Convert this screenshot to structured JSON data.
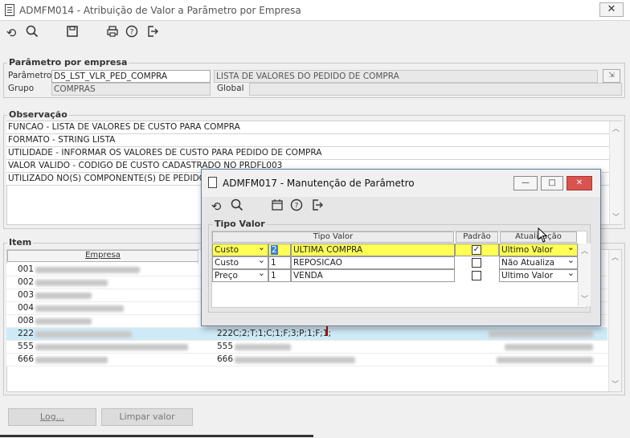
{
  "window": {
    "title": "ADMFM014 - Atribuição de Valor a Parâmetro por Empresa",
    "close_glyph": "✕"
  },
  "toolbar": {
    "icons": [
      "refresh-icon",
      "search-icon",
      "save-icon",
      "print-icon",
      "help-icon",
      "exit-icon"
    ]
  },
  "parametro_group": {
    "title": "Parâmetro por empresa",
    "parametro_label": "Parâmetro",
    "parametro_value": "DS_LST_VLR_PED_COMPRA",
    "parametro_desc": "LISTA DE VALORES DO PEDIDO DE COMPRA",
    "grupo_label": "Grupo",
    "grupo_value": "COMPRAS",
    "global_label": "Global",
    "global_value": ""
  },
  "observacao": {
    "title": "Observação",
    "lines": [
      "FUNCAO - LISTA DE VALORES DE CUSTO PARA COMPRA",
      "FORMATO - STRING LISTA",
      "UTILIDADE - INFORMAR OS VALORES DE CUSTO PARA PEDIDO DE COMPRA",
      "VALOR VALIDO - CODIGO DE CUSTO CADASTRADO NO PRDFL003",
      "UTILIZADO NO(S) COMPONENTE(S) DE PEDIDO DE COMPRA"
    ]
  },
  "item": {
    "title": "Item",
    "col_empresa": "Empresa",
    "rows": [
      {
        "code": "001",
        "code2": "",
        "value": ""
      },
      {
        "code": "002",
        "code2": "",
        "value": ""
      },
      {
        "code": "003",
        "code2": "",
        "value": ""
      },
      {
        "code": "004",
        "code2": "",
        "value": ""
      },
      {
        "code": "008",
        "code2": "",
        "value": ""
      },
      {
        "code": "222",
        "code2": "222",
        "value": "C;2;T;1;C;1;F;3;P;1;F;1;"
      },
      {
        "code": "555",
        "code2": "555",
        "value": ""
      },
      {
        "code": "666",
        "code2": "666",
        "value": ""
      }
    ]
  },
  "buttons": {
    "log": "Log...",
    "limpar": "Limpar valor"
  },
  "modal": {
    "title": "ADMFM017 - Manutenção de Parâmetro",
    "min_glyph": "—",
    "max_glyph": "□",
    "close_glyph": "✕",
    "group_title": "Tipo Valor",
    "headers": {
      "tipo_valor": "Tipo Valor",
      "padrao": "Padrão",
      "atualizacao": "Atualização"
    },
    "rows": [
      {
        "tipo": "Custo",
        "codigo": "2",
        "descricao": "ULTIMA COMPRA",
        "padrao": "✓",
        "atualizacao": "Ultimo Valor"
      },
      {
        "tipo": "Custo",
        "codigo": "1",
        "descricao": "REPOSICAO",
        "padrao": "",
        "atualizacao": "Não Atualiza"
      },
      {
        "tipo": "Preço",
        "codigo": "1",
        "descricao": "VENDA",
        "padrao": "",
        "atualizacao": "Ultimo Valor"
      }
    ]
  },
  "colors": {
    "selected_row": "#cfeaf7",
    "highlight_yellow": "#ffff55",
    "arrow_red": "#c00000"
  }
}
